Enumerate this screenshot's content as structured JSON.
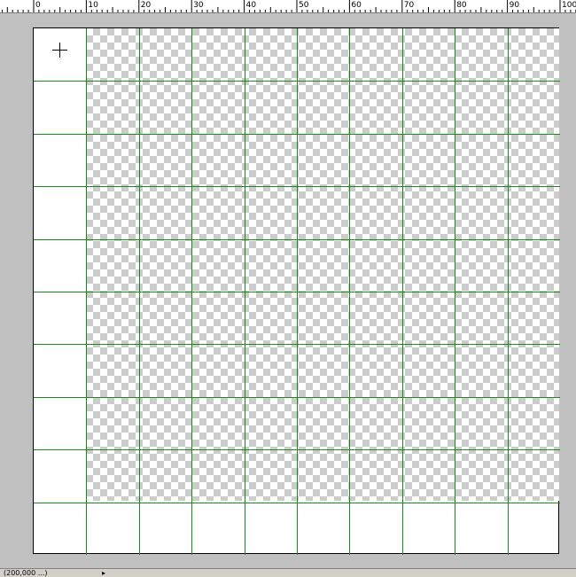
{
  "ruler": {
    "labels": [
      "0",
      "10",
      "20",
      "30",
      "40",
      "50",
      "60",
      "70",
      "80",
      "90",
      "100"
    ]
  },
  "grid": {
    "columns": 10,
    "rows": 10,
    "line_color": "#1a8a1a",
    "checker_color": "#cccccc",
    "background_color": "#c0c0c0"
  },
  "status": {
    "zoom_text": "(200,000 ...)",
    "arrow": "▸"
  },
  "icons": {
    "cursor": "crosshair-icon"
  }
}
